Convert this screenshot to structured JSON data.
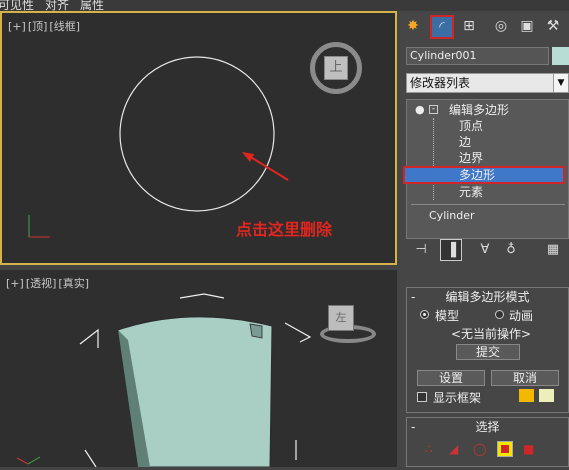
{
  "menubar": {
    "items": [
      "可见性",
      "对齐",
      "属性"
    ]
  },
  "viewport_top": {
    "label_parts": [
      "[+]",
      "[顶]",
      "[线框]"
    ],
    "viewcube_face": "上"
  },
  "viewport_persp": {
    "label_parts": [
      "[+]",
      "[透视]",
      "[真实]"
    ],
    "viewcube_face": "左"
  },
  "annotation": {
    "text": "点击这里删除",
    "color": "#e0261f"
  },
  "right_panel": {
    "tabs": [
      "create-tab",
      "modify-tab",
      "hierarchy-tab",
      "motion-tab",
      "display-tab",
      "utilities-tab"
    ],
    "object_name": "Cylinder001",
    "object_color": "#b8ddd4",
    "modifier_list": "修改器列表",
    "stack": {
      "modifier": "编辑多边形",
      "subobjects": [
        "顶点",
        "边",
        "边界",
        "多边形",
        "元素"
      ],
      "selected": "多边形",
      "base": "Cylinder"
    },
    "edit_poly_mode": {
      "title": "编辑多边形模式",
      "radio_model": "模型",
      "radio_animate": "动画",
      "status": "<无当前操作>",
      "commit": "提交",
      "settings": "设置",
      "cancel": "取消",
      "show_cage": "显示框架",
      "cage_colors": [
        "#f5b800",
        "#eeeebb"
      ]
    },
    "selection": {
      "title": "选择"
    }
  }
}
